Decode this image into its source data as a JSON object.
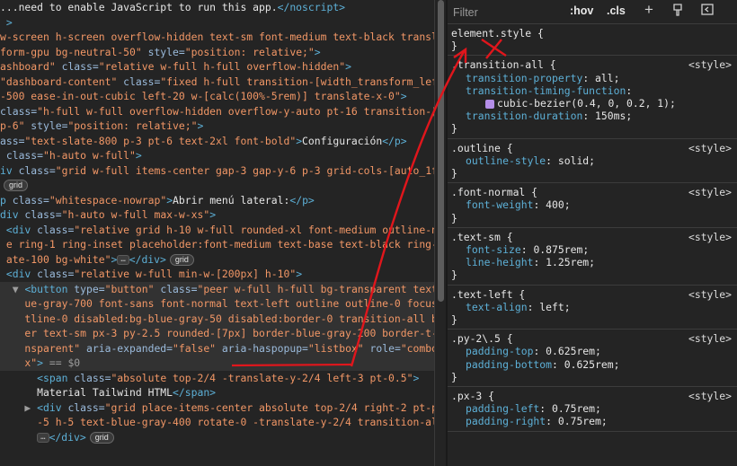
{
  "elements": {
    "lines": [
      {
        "sel": false,
        "parts": [
          [
            "x",
            "...need to enable JavaScript to run this app."
          ],
          [
            "t",
            "</noscript>"
          ]
        ]
      },
      {
        "sel": false,
        "parts": [
          [
            "t",
            " >"
          ]
        ]
      },
      {
        "sel": false,
        "parts": [
          [
            "v",
            "w-screen h-screen overflow-hidden text-sm font-medium text-black transla"
          ]
        ]
      },
      {
        "sel": false,
        "parts": [
          [
            "v",
            "form-gpu bg-neutral-50\""
          ],
          [
            "a",
            " style="
          ],
          [
            "v",
            "\"position: relative;\""
          ],
          [
            "t",
            ">"
          ]
        ]
      },
      {
        "sel": false,
        "parts": [
          [
            "v",
            "ashboard\""
          ],
          [
            "a",
            " class="
          ],
          [
            "v",
            "\"relative w-full h-full overflow-hidden\""
          ],
          [
            "t",
            ">"
          ]
        ]
      },
      {
        "sel": false,
        "parts": [
          [
            "v",
            "\"dashboard-content\""
          ],
          [
            "a",
            " class="
          ],
          [
            "v",
            "\"fixed h-full transition-[width_transform_left]"
          ]
        ]
      },
      {
        "sel": false,
        "parts": [
          [
            "v",
            "-500 ease-in-out-cubic left-20 w-[calc(100%-5rem)] translate-x-0\""
          ],
          [
            "t",
            ">"
          ]
        ]
      },
      {
        "sel": false,
        "parts": [
          [
            "a",
            "class="
          ],
          [
            "v",
            "\"h-full w-full overflow-hidden overflow-y-auto pt-16 transition-[pad"
          ]
        ]
      },
      {
        "sel": false,
        "parts": [
          [
            "v",
            "p-6\""
          ],
          [
            "a",
            " style="
          ],
          [
            "v",
            "\"position: relative;\""
          ],
          [
            "t",
            ">"
          ]
        ]
      },
      {
        "sel": false,
        "parts": [
          [
            "a",
            "ass="
          ],
          [
            "v",
            "\"text-slate-800 p-3 pt-6 text-2xl font-bold\""
          ],
          [
            "t",
            ">"
          ],
          [
            "x",
            "Configuración"
          ],
          [
            "t",
            "</p>"
          ]
        ]
      },
      {
        "sel": false,
        "parts": [
          [
            "a",
            " class="
          ],
          [
            "v",
            "\"h-auto w-full\""
          ],
          [
            "t",
            ">"
          ]
        ]
      },
      {
        "sel": false,
        "parts": [
          [
            "t",
            "iv"
          ],
          [
            "a",
            " class="
          ],
          [
            "v",
            "\"grid w-full items-center gap-3 gap-y-6 p-3 grid-cols-[auto_1fr]"
          ]
        ]
      },
      {
        "sel": false,
        "parts": [],
        "badge": "badge_grid"
      },
      {
        "sel": false,
        "parts": [
          [
            "t",
            "p"
          ],
          [
            "a",
            " class="
          ],
          [
            "v",
            "\"whitespace-nowrap\""
          ],
          [
            "t",
            ">"
          ],
          [
            "x",
            "Abrir menú lateral:"
          ],
          [
            "t",
            "</p>"
          ]
        ]
      },
      {
        "sel": false,
        "parts": [
          [
            "t",
            "div"
          ],
          [
            "a",
            " class="
          ],
          [
            "v",
            "\"h-auto w-full max-w-xs\""
          ],
          [
            "t",
            ">"
          ]
        ]
      },
      {
        "sel": false,
        "parts": [
          [
            "t",
            " <div"
          ],
          [
            "a",
            " class="
          ],
          [
            "v",
            "\"relative grid h-10 w-full rounded-xl font-medium outline-non"
          ]
        ]
      },
      {
        "sel": false,
        "parts": [
          [
            "v",
            " e ring-1 ring-inset placeholder:font-medium text-base text-black ring-sl"
          ]
        ]
      },
      {
        "sel": false,
        "parts": [
          [
            "v",
            " ate-100 bg-white\""
          ],
          [
            "t",
            ">"
          ]
        ],
        "ellip": true,
        "close": "</div>",
        "badge": "badge_grid"
      },
      {
        "sel": false,
        "parts": [
          [
            "t",
            " <div"
          ],
          [
            "a",
            " class="
          ],
          [
            "v",
            "\"relative w-full min-w-[200px] h-10\""
          ],
          [
            "t",
            ">"
          ]
        ]
      },
      {
        "sel": true,
        "parts": [
          [
            "g",
            "  ▼ "
          ],
          [
            "t",
            "<button"
          ],
          [
            "a",
            " type="
          ],
          [
            "v",
            "\"button\""
          ],
          [
            "a",
            " class="
          ],
          [
            "v",
            "\"peer w-full h-full bg-transparent text-bl"
          ]
        ]
      },
      {
        "sel": true,
        "parts": [
          [
            "v",
            "    ue-gray-700 font-sans font-normal text-left outline outline-0 focus:ou"
          ]
        ]
      },
      {
        "sel": true,
        "parts": [
          [
            "v",
            "    tline-0 disabled:bg-blue-gray-50 disabled:border-0 transition-all bord"
          ]
        ]
      },
      {
        "sel": true,
        "parts": [
          [
            "v",
            "    er text-sm px-3 py-2.5 rounded-[7px] border-blue-gray-200 border-t-tra"
          ]
        ]
      },
      {
        "sel": true,
        "parts": [
          [
            "v",
            "    nsparent\""
          ],
          [
            "a",
            " aria-expanded="
          ],
          [
            "v",
            "\"false\""
          ],
          [
            "a",
            " aria-haspopup="
          ],
          [
            "v",
            "\"listbox\""
          ],
          [
            "a",
            " role="
          ],
          [
            "v",
            "\"combobo"
          ]
        ]
      },
      {
        "sel": true,
        "parts": [
          [
            "v",
            "    x\""
          ],
          [
            "t",
            ">"
          ],
          [
            "g",
            " == $0"
          ]
        ]
      },
      {
        "sel": false,
        "parts": [
          [
            "t",
            "      <span"
          ],
          [
            "a",
            " class="
          ],
          [
            "v",
            "\"absolute top-2/4 -translate-y-2/4 left-3 pt-0.5\""
          ],
          [
            "t",
            ">"
          ]
        ]
      },
      {
        "sel": false,
        "parts": [
          [
            "x",
            "      Material Tailwind HTML"
          ],
          [
            "t",
            "</span>"
          ]
        ]
      },
      {
        "sel": false,
        "parts": [
          [
            "g",
            "    ▶ "
          ],
          [
            "t",
            "<div"
          ],
          [
            "a",
            " class="
          ],
          [
            "v",
            "\"grid place-items-center absolute top-2/4 right-2 pt-px w"
          ]
        ]
      },
      {
        "sel": false,
        "parts": [
          [
            "v",
            "      -5 h-5 text-blue-gray-400 rotate-0 -translate-y-2/4 transition-all\""
          ],
          [
            "t",
            ">"
          ]
        ]
      },
      {
        "sel": false,
        "parts": [
          [
            "g",
            "      "
          ]
        ],
        "ellip": true,
        "close": "</div>",
        "badge": "badge_grid"
      }
    ]
  },
  "badge_grid": "grid",
  "styles": {
    "filter_placeholder": "Filter",
    "hov_label": ":hov",
    "cls_label": ".cls",
    "rules": [
      {
        "selector": "element.style {",
        "source": "",
        "decls": [],
        "close": "}"
      },
      {
        "selector": ".transition-all {",
        "source": "<style>",
        "decls": [
          {
            "prop": "transition-property",
            "val": "all;"
          },
          {
            "prop": "transition-timing-function",
            "val": ""
          },
          {
            "prop": "",
            "val": "cubic-bezier(0.4, 0, 0.2, 1);",
            "swatch": true
          },
          {
            "prop": "transition-duration",
            "val": "150ms;"
          }
        ],
        "close": "}"
      },
      {
        "selector": ".outline {",
        "source": "<style>",
        "decls": [
          {
            "prop": "outline-style",
            "val": "solid;"
          }
        ],
        "close": "}"
      },
      {
        "selector": ".font-normal {",
        "source": "<style>",
        "decls": [
          {
            "prop": "font-weight",
            "val": "400;"
          }
        ],
        "close": "}"
      },
      {
        "selector": ".text-sm {",
        "source": "<style>",
        "decls": [
          {
            "prop": "font-size",
            "val": "0.875rem;"
          },
          {
            "prop": "line-height",
            "val": "1.25rem;"
          }
        ],
        "close": "}"
      },
      {
        "selector": ".text-left {",
        "source": "<style>",
        "decls": [
          {
            "prop": "text-align",
            "val": "left;"
          }
        ],
        "close": "}"
      },
      {
        "selector": ".py-2\\.5 {",
        "source": "<style>",
        "decls": [
          {
            "prop": "padding-top",
            "val": "0.625rem;"
          },
          {
            "prop": "padding-bottom",
            "val": "0.625rem;"
          }
        ],
        "close": "}"
      },
      {
        "selector": ".px-3 {",
        "source": "<style>",
        "decls": [
          {
            "prop": "padding-left",
            "val": "0.75rem;"
          },
          {
            "prop": "padding-right",
            "val": "0.75rem;"
          }
        ],
        "close": ""
      }
    ]
  },
  "colors": {
    "annotation": "#e0161c"
  }
}
